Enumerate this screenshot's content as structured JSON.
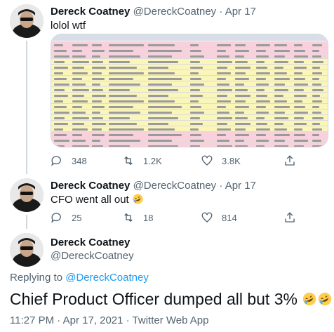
{
  "tweets": [
    {
      "name": "Dereck Coatney",
      "handle": "@DereckCoatney",
      "sep": "·",
      "date": "Apr 17",
      "text": "lolol wtf",
      "replies": "348",
      "retweets": "1.2K",
      "likes": "3.8K"
    },
    {
      "name": "Dereck Coatney",
      "handle": "@DereckCoatney",
      "sep": "·",
      "date": "Apr 17",
      "text": "CFO went all out",
      "replies": "25",
      "retweets": "18",
      "likes": "814"
    }
  ],
  "main_tweet": {
    "name": "Dereck Coatney",
    "handle": "@DereckCoatney",
    "replying_prefix": "Replying to",
    "replying_to": "@DereckCoatney",
    "text": "Chief Product Officer dumped all but 3%",
    "timestamp": "11:27 PM · Apr 17, 2021 · Twitter Web App"
  },
  "colors": {
    "text": "#0f1419",
    "muted": "#536471",
    "link": "#1d9bf0",
    "sheet_pink": "#f9d1dd",
    "sheet_yellow": "#faf5b8",
    "sheet_header": "#d9dde7"
  },
  "icons": [
    "reply-icon",
    "retweet-icon",
    "like-icon",
    "share-icon",
    "rofl-emoji"
  ],
  "sheet_rows": [
    "pink",
    "pink",
    "pink",
    "yellow",
    "yellow",
    "yellow",
    "yellow",
    "yellow",
    "yellow",
    "yellow",
    "yellow",
    "yellow",
    "yellow",
    "yellow",
    "yellow",
    "yellow",
    "pink",
    "pink",
    "pink"
  ]
}
